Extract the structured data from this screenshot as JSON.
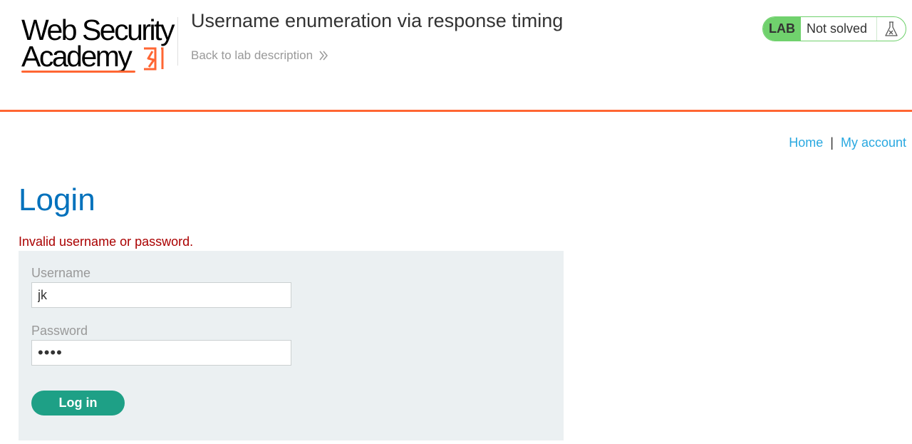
{
  "header": {
    "logo": {
      "line1": "Web Security",
      "line2": "Academy"
    },
    "lab_title": "Username enumeration via response timing",
    "back_link": "Back to lab description",
    "status": {
      "badge": "LAB",
      "text": "Not solved",
      "icon": "flask-icon"
    }
  },
  "nav": {
    "home": "Home",
    "separator": "|",
    "account": "My account"
  },
  "page": {
    "title": "Login",
    "error": "Invalid username or password."
  },
  "form": {
    "username_label": "Username",
    "username_value": "jk",
    "password_label": "Password",
    "password_value": "abcd",
    "submit_label": "Log in"
  },
  "colors": {
    "accent": "#ff6633",
    "title_blue": "#0071bc",
    "link_blue": "#29a8e0",
    "error_red": "#aa0000",
    "button_green": "#1ea086",
    "status_green": "#70d16d",
    "form_bg": "#ebf0f2"
  }
}
